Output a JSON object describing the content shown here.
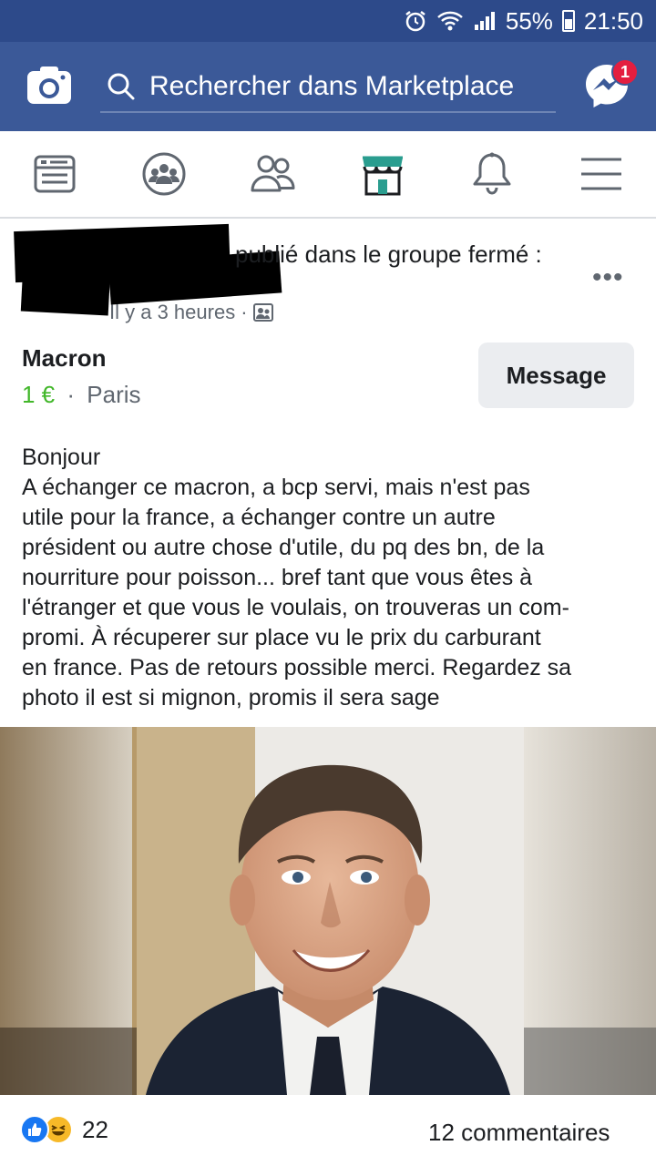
{
  "status_bar": {
    "battery": "55%",
    "time": "21:50"
  },
  "header": {
    "search_placeholder": "Rechercher dans Marketplace",
    "messenger_badge": "1"
  },
  "tabs": [
    {
      "name": "news-feed",
      "icon": "news-feed-icon"
    },
    {
      "name": "groups",
      "icon": "groups-icon"
    },
    {
      "name": "friends",
      "icon": "friends-icon"
    },
    {
      "name": "marketplace",
      "icon": "marketplace-icon",
      "active": true
    },
    {
      "name": "notifications",
      "icon": "bell-icon"
    },
    {
      "name": "menu",
      "icon": "hamburger-icon"
    }
  ],
  "post": {
    "author_action": "publié dans le groupe fermé :",
    "time": "Il y a 3 heures ·",
    "listing": {
      "title": "Macron",
      "price": "1 €",
      "separator": "·",
      "location": "Paris",
      "message_label": "Message"
    },
    "body_lines": [
      "Bonjour",
      "A échanger ce macron, a bcp servi, mais n'est pas",
      "utile pour la france, a échanger contre un autre",
      "président ou autre chose d'utile, du pq des bn, de la",
      "nourriture pour poisson... bref tant que vous êtes à",
      "l'étranger et que vous le voulais, on trouveras un com-",
      "promi. À récuperer sur place vu le prix du carburant",
      "en france. Pas de retours possible merci. Regardez sa",
      "photo il est si mignon, promis il sera sage"
    ],
    "reactions_count": "22",
    "comments_count": "12 commentaires"
  },
  "colors": {
    "header_blue": "#3b5998",
    "status_blue": "#2d4a8a",
    "price_green": "#42b72a",
    "marketplace_teal": "#2a9d8f",
    "badge_red": "#e41e3f"
  }
}
